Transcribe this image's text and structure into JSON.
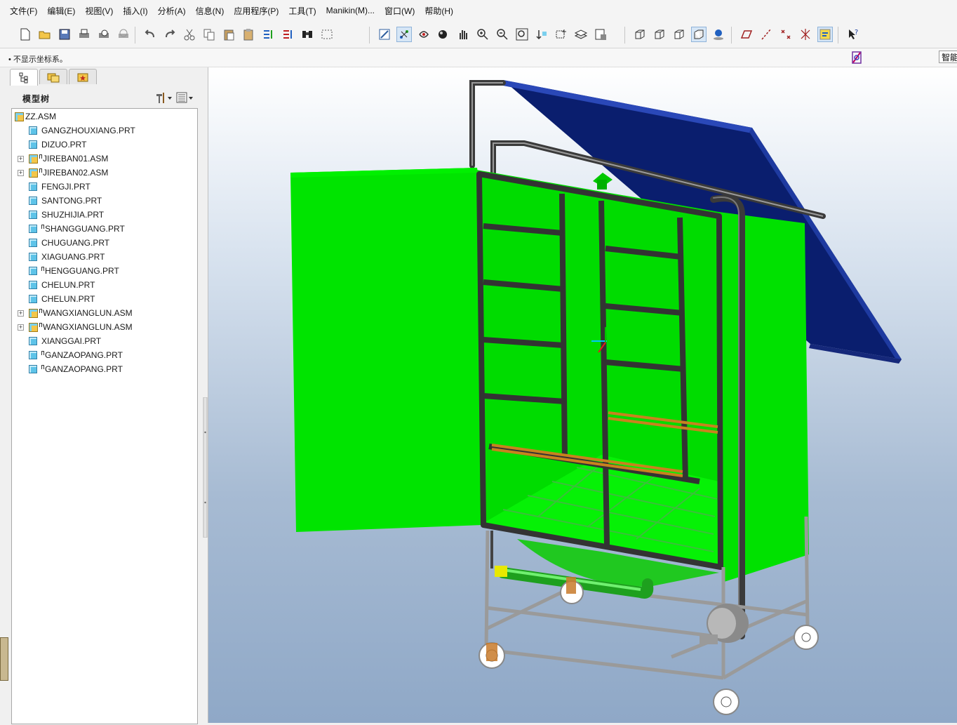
{
  "menu": [
    "文件(F)",
    "编辑(E)",
    "视图(V)",
    "插入(I)",
    "分析(A)",
    "信息(N)",
    "应用程序(P)",
    "工具(T)",
    "Manikin(M)...",
    "窗口(W)",
    "帮助(H)"
  ],
  "status": {
    "message": "• 不显示坐标系。",
    "smart_filter": "智能"
  },
  "panel": {
    "title": "模型树"
  },
  "tree": [
    {
      "label": "ZZ.ASM",
      "type": "asm",
      "level": 0,
      "expandable": false,
      "flag": false
    },
    {
      "label": "GANGZHOUXIANG.PRT",
      "type": "prt",
      "level": 1,
      "expandable": false,
      "flag": false
    },
    {
      "label": "DIZUO.PRT",
      "type": "prt",
      "level": 1,
      "expandable": false,
      "flag": false
    },
    {
      "label": "JIREBAN01.ASM",
      "type": "asm",
      "level": 1,
      "expandable": true,
      "flag": true
    },
    {
      "label": "JIREBAN02.ASM",
      "type": "asm",
      "level": 1,
      "expandable": true,
      "flag": true
    },
    {
      "label": "FENGJI.PRT",
      "type": "prt",
      "level": 1,
      "expandable": false,
      "flag": false
    },
    {
      "label": "SANTONG.PRT",
      "type": "prt",
      "level": 1,
      "expandable": false,
      "flag": false
    },
    {
      "label": "SHUZHIJIA.PRT",
      "type": "prt",
      "level": 1,
      "expandable": false,
      "flag": false
    },
    {
      "label": "SHANGGUANG.PRT",
      "type": "prt",
      "level": 1,
      "expandable": false,
      "flag": true
    },
    {
      "label": "CHUGUANG.PRT",
      "type": "prt",
      "level": 1,
      "expandable": false,
      "flag": false
    },
    {
      "label": "XIAGUANG.PRT",
      "type": "prt",
      "level": 1,
      "expandable": false,
      "flag": false
    },
    {
      "label": "HENGGUANG.PRT",
      "type": "prt",
      "level": 1,
      "expandable": false,
      "flag": true
    },
    {
      "label": "CHELUN.PRT",
      "type": "prt",
      "level": 1,
      "expandable": false,
      "flag": false
    },
    {
      "label": "CHELUN.PRT",
      "type": "prt",
      "level": 1,
      "expandable": false,
      "flag": false
    },
    {
      "label": "WANGXIANGLUN.ASM",
      "type": "asm",
      "level": 1,
      "expandable": true,
      "flag": true
    },
    {
      "label": "WANGXIANGLUN.ASM",
      "type": "asm",
      "level": 1,
      "expandable": true,
      "flag": true
    },
    {
      "label": "XIANGGAI.PRT",
      "type": "prt",
      "level": 1,
      "expandable": false,
      "flag": false
    },
    {
      "label": "GANZAOPANG.PRT",
      "type": "prt",
      "level": 1,
      "expandable": false,
      "flag": true
    },
    {
      "label": "GANZAOPANG.PRT",
      "type": "prt",
      "level": 1,
      "expandable": false,
      "flag": true
    }
  ],
  "toolbar_groups": [
    [
      "new-file-icon",
      "open-folder-icon",
      "save-icon",
      "print-icon",
      "print-preview-icon",
      "quick-print-icon"
    ],
    [
      "undo-icon",
      "redo-icon",
      "cut-icon",
      "copy-icon",
      "paste-icon",
      "paste-special-icon",
      "regenerate-icon",
      "regenerate-manager-icon",
      "find-icon",
      "select-box-icon"
    ],
    [
      "repaint-icon",
      "spin-center-icon",
      "orient-mode-icon",
      "appearance-icon",
      "pan-icon",
      "zoom-in-icon",
      "zoom-out-icon",
      "refit-icon",
      "reorient-icon",
      "saved-views-icon",
      "layers-icon",
      "view-manager-icon"
    ],
    [
      "wireframe-icon",
      "hidden-line-icon",
      "no-hidden-icon",
      "shading-icon",
      "enhanced-realism-icon"
    ],
    [
      "datum-planes-icon",
      "datum-axes-icon",
      "datum-points-icon",
      "coordinate-systems-icon",
      "annotations-icon"
    ],
    [
      "context-help-icon"
    ]
  ],
  "colors": {
    "box_green": "#00e100",
    "frame": "#333333",
    "panel_blue": "#0a1e6e",
    "viewport_top": "#ffffff",
    "viewport_bottom": "#8fa8c7"
  }
}
